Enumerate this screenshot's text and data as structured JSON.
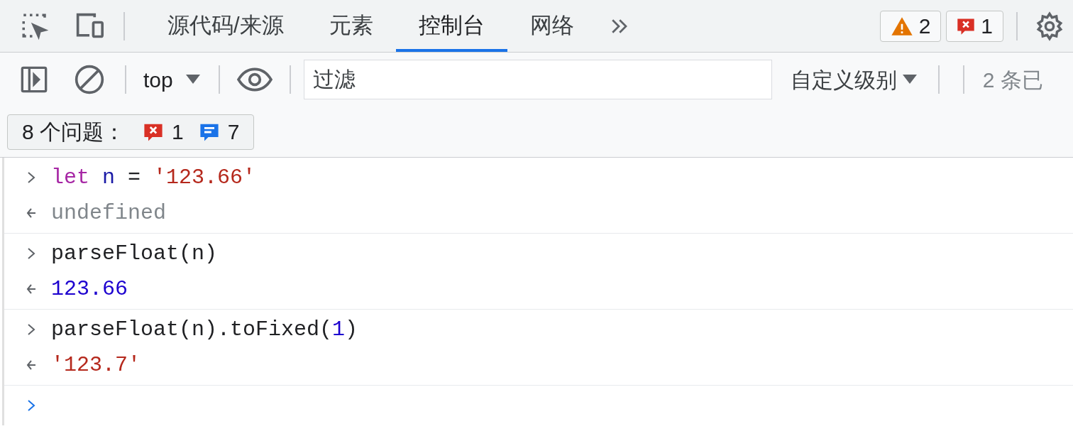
{
  "top_bar": {
    "tabs": [
      {
        "label": "源代码/来源",
        "selected": false
      },
      {
        "label": "元素",
        "selected": false
      },
      {
        "label": "控制台",
        "selected": true
      },
      {
        "label": "网络",
        "selected": false
      }
    ],
    "warnings": "2",
    "errors": "1"
  },
  "console_toolbar": {
    "context": "top",
    "filter_placeholder": "过滤",
    "levels": "自定义级别",
    "hidden": "2 条已"
  },
  "issues": {
    "label": "8 个问题：",
    "errors": "1",
    "info": "7"
  },
  "entries": [
    {
      "input": [
        {
          "text": "let",
          "kind": "keyword"
        },
        {
          "text": " n",
          "kind": "variable"
        },
        {
          "text": " = ",
          "kind": "plain"
        },
        {
          "text": "'123.66'",
          "kind": "string"
        }
      ],
      "output": {
        "text": "undefined",
        "kind": "undefined"
      }
    },
    {
      "input": [
        {
          "text": "parseFloat(n)",
          "kind": "plain"
        }
      ],
      "output": {
        "text": "123.66",
        "kind": "number"
      }
    },
    {
      "input": [
        {
          "text": "parseFloat(n).toFixed(",
          "kind": "plain"
        },
        {
          "text": "1",
          "kind": "number"
        },
        {
          "text": ")",
          "kind": "plain"
        }
      ],
      "output": {
        "text": "'123.7'",
        "kind": "string"
      }
    }
  ]
}
